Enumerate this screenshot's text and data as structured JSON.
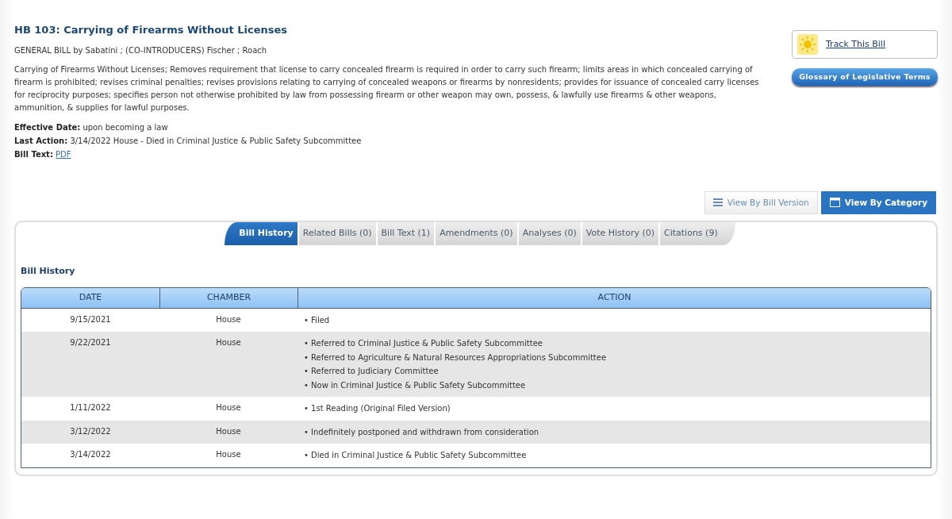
{
  "bill": {
    "title": "HB 103: Carrying of Firearms Without Licenses",
    "sponsors": "GENERAL BILL by Sabatini ; (CO-INTRODUCERS) Fischer ; Roach",
    "summary": "Carrying of Firearms Without Licenses; Removes requirement that license to carry concealed firearm is required in order to carry such firearm; limits areas in which concealed carrying of firearm is prohibited; revises criminal penalties; revises provisions relating to carrying of concealed weapons or firearms by nonresidents; provides for issuance of concealed carry licenses for reciprocity purposes; specifies person not otherwise prohibited by law from possessing firearm or other weapon may own, possess, & lawfully use firearms & other weapons, ammunition, & supplies for lawful purposes.",
    "effective_date": "**Effective Date:** upon becoming a law",
    "last_action": "**Last Action:** 3/14/2022 House - Died in Criminal Justice & Public Safety Subcommittee",
    "bill_text_label": "Bill Text:",
    "bill_text_link": "PDF"
  },
  "sidebar": {
    "track_link": "Track This Bill",
    "glossary_button": "Glossary of Legislative Terms"
  },
  "view_buttons": [
    {
      "label": "View By Bill Version",
      "selected": false
    },
    {
      "label": "View By Category",
      "selected": true
    }
  ],
  "tabs": [
    {
      "label": "Bill History",
      "selected": true
    },
    {
      "label": "Related Bills (0)",
      "selected": false
    },
    {
      "label": "Bill Text (1)",
      "selected": false
    },
    {
      "label": "Amendments (0)",
      "selected": false
    },
    {
      "label": "Analyses (0)",
      "selected": false
    },
    {
      "label": "Vote History (0)",
      "selected": false
    },
    {
      "label": "Citations (9)",
      "selected": false
    }
  ],
  "section_title": "Bill History",
  "table": {
    "columns": [
      "DATE",
      "CHAMBER",
      "ACTION"
    ],
    "rows": [
      {
        "date": "9/15/2021",
        "chamber": "House",
        "actions": [
          "• Filed"
        ]
      },
      {
        "date": "9/22/2021",
        "chamber": "House",
        "actions": [
          "• Referred to Criminal Justice & Public Safety Subcommittee",
          "• Referred to Agriculture & Natural Resources Appropriations Subcommittee",
          "• Referred to Judiciary Committee",
          "• Now in Criminal Justice & Public Safety Subcommittee"
        ]
      },
      {
        "date": "1/11/2022",
        "chamber": "House",
        "actions": [
          "• 1st Reading (Original Filed Version)"
        ]
      },
      {
        "date": "3/12/2022",
        "chamber": "House",
        "actions": [
          "• Indefinitely postponed and withdrawn from consideration"
        ]
      },
      {
        "date": "3/14/2022",
        "chamber": "House",
        "actions": [
          "• Died in Criminal Justice & Public Safety Subcommittee"
        ]
      }
    ]
  }
}
